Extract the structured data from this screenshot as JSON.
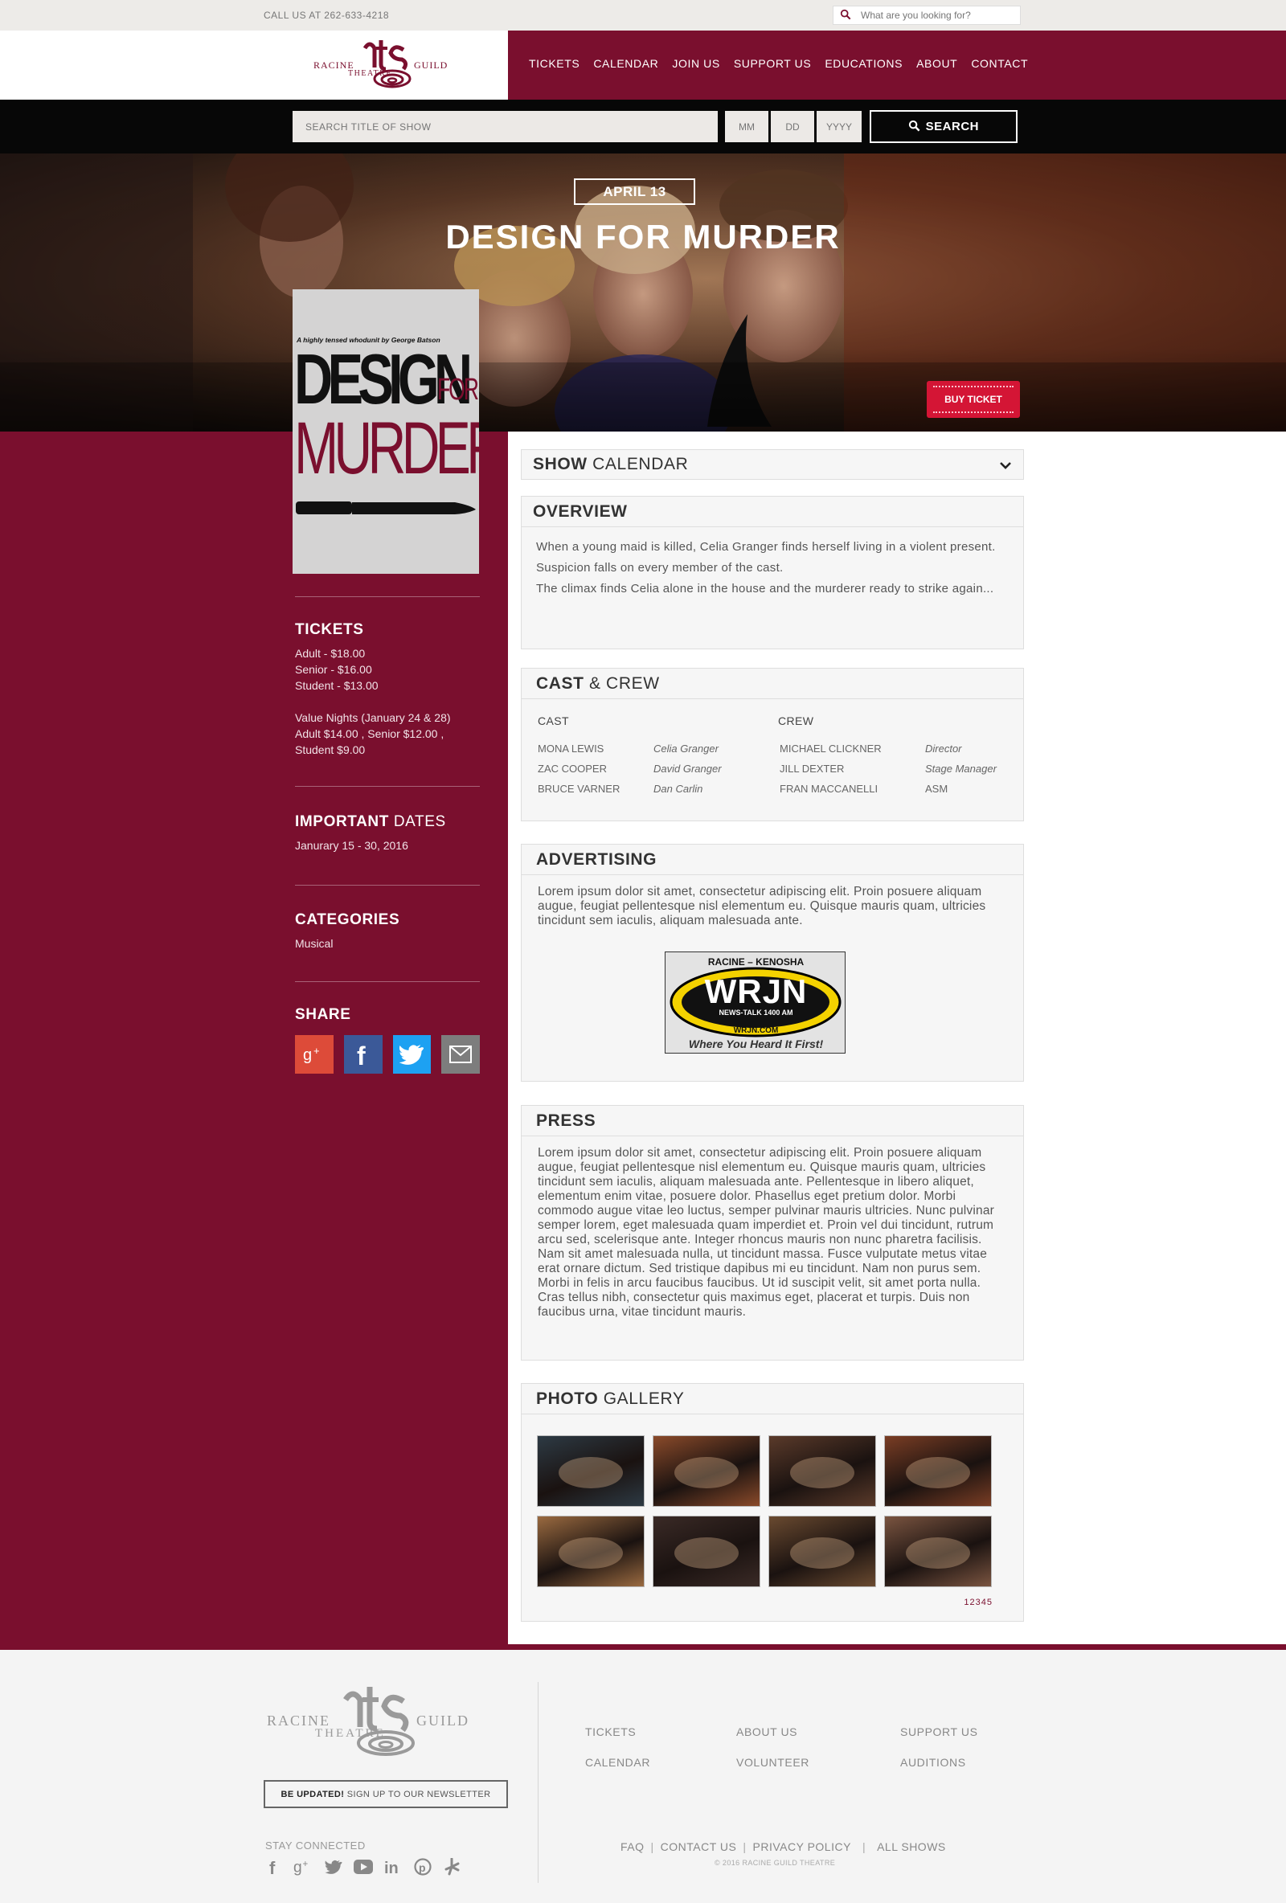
{
  "utility": {
    "phone": "CALL US AT 262-633-4218",
    "search_placeholder": "What are you looking for?"
  },
  "brand": {
    "racine": "RACINE",
    "guild": "GUILD",
    "theatre": "THEATRE"
  },
  "nav": [
    "TICKETS",
    "CALENDAR",
    "JOIN US",
    "SUPPORT US",
    "EDUCATIONS",
    "ABOUT",
    "CONTACT"
  ],
  "show_search": {
    "title_placeholder": "SEARCH TITLE OF SHOW",
    "mm": "MM",
    "dd": "DD",
    "yyyy": "YYYY",
    "button": "SEARCH"
  },
  "hero": {
    "date": "APRIL 13",
    "title": "DESIGN FOR MURDER",
    "buy_ticket": "BUY TICKET"
  },
  "poster": {
    "tagline": "A highly tensed whodunit by George Batson",
    "design": "DESIGN",
    "for": "FOR",
    "murder": "MURDER"
  },
  "sidebar": {
    "tickets_heading": "TICKETS",
    "tickets_lines": [
      "Adult - $18.00",
      "Senior - $16.00",
      "Student - $13.00"
    ],
    "value_nights": [
      "Value Nights (January 24 & 28)",
      "Adult $14.00 , Senior $12.00 ,",
      "Student $9.00"
    ],
    "dates_heading_bold": "IMPORTANT",
    "dates_heading_light": "DATES",
    "dates_value": "Janurary 15 - 30, 2016",
    "categories_heading": "CATEGORIES",
    "categories_value": "Musical",
    "share_heading": "SHARE",
    "share_icons": [
      "google-plus-icon",
      "facebook-icon",
      "twitter-icon",
      "mail-icon"
    ]
  },
  "show_calendar": {
    "bold": "SHOW",
    "light": "CALENDAR"
  },
  "overview": {
    "heading": "OVERVIEW",
    "paragraphs": [
      "When a young maid is killed, Celia Granger finds herself living in a violent present.",
      "Suspicion falls on every member of the cast.",
      "The climax finds Celia alone in the house and the murderer ready to strike again..."
    ]
  },
  "cast_crew": {
    "heading_bold": "CAST",
    "heading_light": "& CREW",
    "cast_label": "CAST",
    "crew_label": "CREW",
    "cast": [
      [
        "MONA LEWIS",
        "Celia Granger"
      ],
      [
        "ZAC COOPER",
        "David Granger"
      ],
      [
        "BRUCE VARNER",
        "Dan Carlin"
      ]
    ],
    "crew": [
      [
        "MICHAEL CLICKNER",
        "Director"
      ],
      [
        "JILL DEXTER",
        "Stage Manager"
      ],
      [
        "FRAN MACCANELLI",
        "ASM"
      ]
    ]
  },
  "advertising": {
    "heading": "ADVERTISING",
    "text": "Lorem ipsum dolor sit amet, consectetur adipiscing elit. Proin posuere aliquam augue, feugiat pellentesque nisl elementum eu. Quisque mauris quam, ultricies tincidunt sem iaculis, aliquam malesuada ante.",
    "ad": {
      "top": "RACINE – KENOSHA",
      "name": "WRJN",
      "sub": "NEWS-TALK 1400 AM",
      "url": "WRJN.COM",
      "slogan": "Where You Heard It First!"
    }
  },
  "press": {
    "heading": "PRESS",
    "text": "Lorem ipsum dolor sit amet, consectetur adipiscing elit. Proin posuere aliquam augue, feugiat pellentesque nisl elementum eu. Quisque mauris quam, ultricies tincidunt sem iaculis, aliquam malesuada ante. Pellentesque in libero aliquet, elementum enim vitae, posuere dolor. Phasellus eget pretium dolor. Morbi commodo augue vitae leo luctus, semper pulvinar mauris ultricies. Nunc pulvinar semper lorem, eget malesuada quam imperdiet et. Proin vel dui tincidunt, rutrum arcu sed, scelerisque ante. Integer rhoncus mauris non nunc pharetra facilisis. Nam sit amet malesuada nulla, ut tincidunt massa. Fusce vulputate metus vitae erat ornare dictum. Sed tristique dapibus mi eu tincidunt. Nam non purus sem. Morbi in felis in arcu faucibus faucibus. Ut id suscipit velit, sit amet porta nulla. Cras tellus nibh, consectetur quis maximus eget, placerat et turpis. Duis non faucibus urna, vitae tincidunt mauris."
  },
  "gallery": {
    "heading_bold": "PHOTO",
    "heading_light": "GALLERY",
    "pages": [
      "1",
      "2",
      "3",
      "4",
      "5"
    ],
    "photo_colors": [
      "#2d3a44",
      "#8a4a2a",
      "#5a3a2a",
      "#7a3d24",
      "#9a6a40",
      "#3a2a26",
      "#6a4a30",
      "#7a5440"
    ]
  },
  "footer": {
    "col1": [
      "TICKETS",
      "CALENDAR"
    ],
    "col2": [
      "ABOUT US",
      "VOLUNTEER"
    ],
    "col3": [
      "SUPPORT US",
      "AUDITIONS"
    ],
    "newsletter_bold": "BE UPDATED!",
    "newsletter_rest": " SIGN UP TO OUR NEWSLETTER",
    "stay_connected": "STAY CONNECTED",
    "socials": [
      "facebook-icon",
      "google-plus-icon",
      "twitter-icon",
      "youtube-icon",
      "linkedin-icon",
      "pinterest-icon",
      "yelp-icon"
    ],
    "legal": [
      "FAQ",
      "CONTACT US",
      "PRIVACY POLICY",
      "ALL SHOWS"
    ],
    "copyright": "© 2016 RACINE GUILD THEATRE"
  },
  "colors": {
    "brand_maroon": "#7a0f2e",
    "ticket_red": "#d41535",
    "twitter": "#1da1f2",
    "facebook": "#3b5998",
    "google": "#dd4b39"
  }
}
